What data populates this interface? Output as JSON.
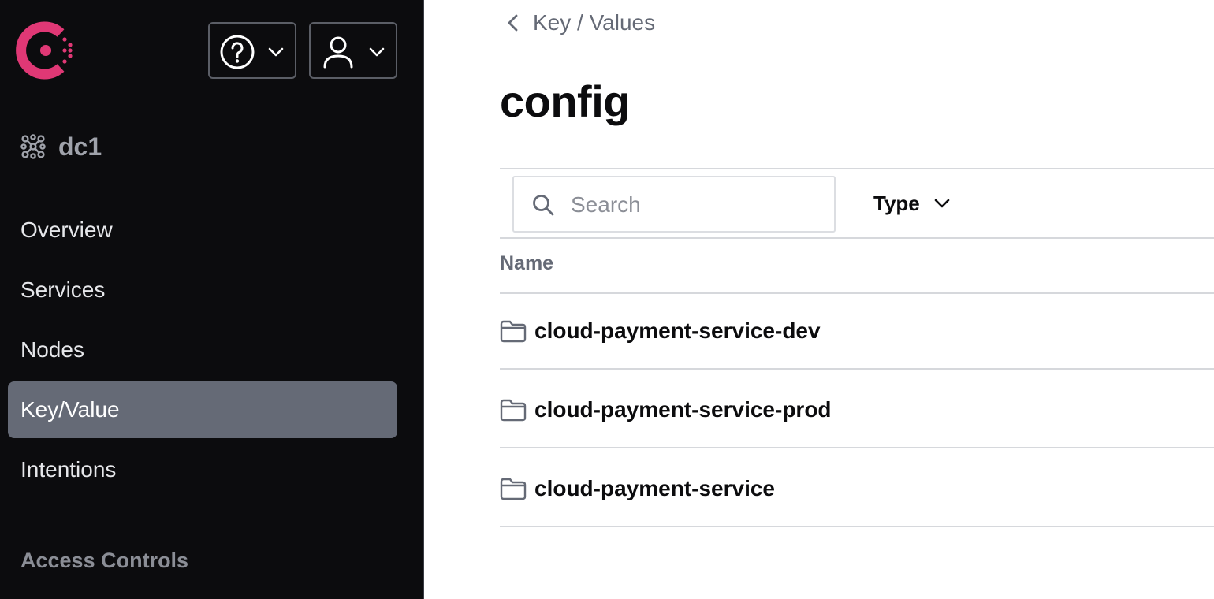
{
  "header": {
    "help_icon": "help-circle-icon",
    "user_icon": "user-icon"
  },
  "datacenter": {
    "label": "dc1"
  },
  "nav": {
    "items": [
      {
        "label": "Overview",
        "active": false
      },
      {
        "label": "Services",
        "active": false
      },
      {
        "label": "Nodes",
        "active": false
      },
      {
        "label": "Key/Value",
        "active": true
      },
      {
        "label": "Intentions",
        "active": false
      }
    ],
    "section_label": "Access Controls"
  },
  "breadcrumb": {
    "label": "Key / Values"
  },
  "page": {
    "title": "config"
  },
  "search": {
    "placeholder": "Search",
    "value": ""
  },
  "filter": {
    "type_label": "Type"
  },
  "table": {
    "column_name": "Name",
    "rows": [
      {
        "name": "cloud-payment-service-dev",
        "icon": "folder-icon"
      },
      {
        "name": "cloud-payment-service-prod",
        "icon": "folder-icon"
      },
      {
        "name": "cloud-payment-service",
        "icon": "folder-icon"
      }
    ]
  },
  "colors": {
    "brand": "#e03875",
    "sidebar_bg": "#0c0c0e",
    "active_nav": "#656a76"
  }
}
